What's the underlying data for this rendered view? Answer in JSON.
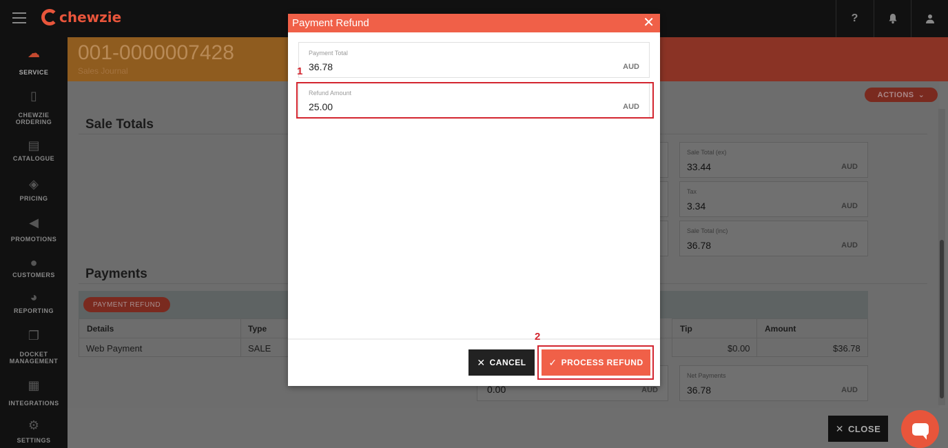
{
  "app": {
    "brand": "chewzie"
  },
  "topbar": {
    "help_icon": "?",
    "bell_icon": "bell",
    "user_icon": "user"
  },
  "sidebar": {
    "items": [
      {
        "label": "SERVICE",
        "icon": "service-icon"
      },
      {
        "label": "CHEWZIE\nORDERING",
        "icon": "phone-icon"
      },
      {
        "label": "CATALOGUE",
        "icon": "catalogue-icon"
      },
      {
        "label": "PRICING",
        "icon": "tag-icon"
      },
      {
        "label": "PROMOTIONS",
        "icon": "megaphone-icon"
      },
      {
        "label": "CUSTOMERS",
        "icon": "users-icon"
      },
      {
        "label": "REPORTING",
        "icon": "pie-chart-icon"
      },
      {
        "label": "DOCKET\nMANAGEMENT",
        "icon": "docket-icon"
      },
      {
        "label": "INTEGRATIONS",
        "icon": "integrations-icon"
      },
      {
        "label": "SETTINGS",
        "icon": "gear-icon"
      }
    ]
  },
  "header": {
    "title": "001-0000007428",
    "subtitle": "Sales Journal"
  },
  "actions_label": "ACTIONS",
  "sale_totals": {
    "title": "Sale Totals",
    "boxes": [
      {
        "label": "Sale Total (ex)",
        "value": "33.44",
        "unit": "AUD"
      },
      {
        "label": "Tax",
        "value": "3.34",
        "unit": "AUD"
      },
      {
        "label": "Sale Total (inc)",
        "value": "36.78",
        "unit": "AUD"
      }
    ]
  },
  "payments": {
    "title": "Payments",
    "refund_pill": "PAYMENT REFUND",
    "columns": [
      "Details",
      "Type",
      "Tip",
      "Amount"
    ],
    "rows": [
      {
        "details": "Web Payment",
        "type": "SALE",
        "tip": "$0.00",
        "amount": "$36.78"
      }
    ],
    "bottom_left": {
      "value": "0.00",
      "unit": "AUD"
    },
    "net": {
      "label": "Net Payments",
      "value": "36.78",
      "unit": "AUD"
    }
  },
  "close_label": "CLOSE",
  "modal": {
    "title": "Payment Refund",
    "payment_total": {
      "label": "Payment Total",
      "value": "36.78",
      "unit": "AUD"
    },
    "refund_amount": {
      "label": "Refund Amount",
      "value": "25.00",
      "unit": "AUD"
    },
    "cancel_label": "CANCEL",
    "process_label": "PROCESS REFUND",
    "markers": [
      "1",
      "2"
    ]
  },
  "colors": {
    "accent": "#f06048",
    "highlight": "#d3242e",
    "dark": "#111111"
  }
}
